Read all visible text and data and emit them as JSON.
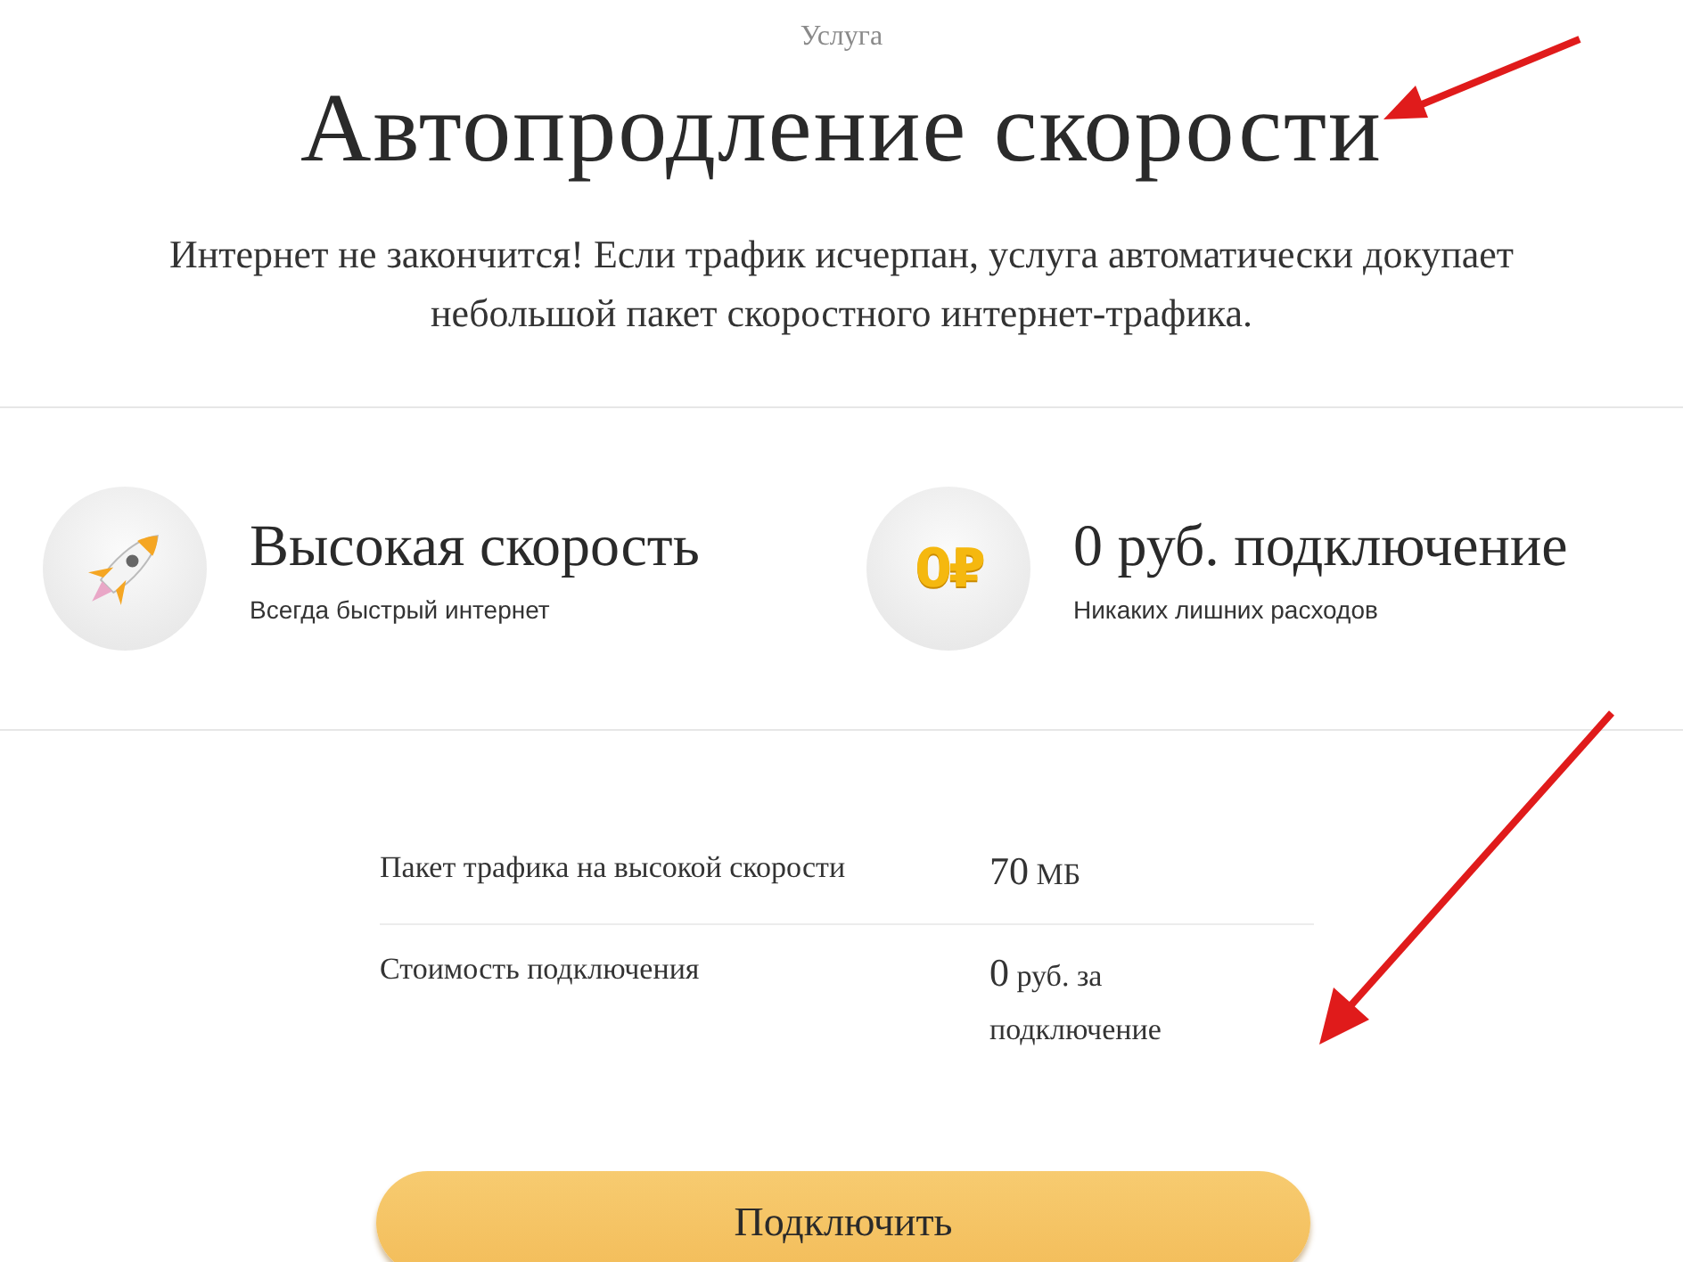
{
  "header": {
    "eyebrow": "Услуга",
    "title": "Автопродление скорости",
    "description": "Интернет не закончится! Если трафик исчерпан, услуга автоматически докупает небольшой пакет скоростного интернет-трафика."
  },
  "features": [
    {
      "kind": "rocket",
      "title": "Высокая скорость",
      "subtitle": "Всегда быстрый интернет"
    },
    {
      "kind": "coin",
      "badge": "0₽",
      "title": "0 руб. подключение",
      "subtitle": "Никаких лишних расходов"
    }
  ],
  "details": [
    {
      "label": "Пакет трафика на высокой скорости",
      "amount": "70",
      "unit": "МБ"
    },
    {
      "label": "Стоимость подключения",
      "amount": "0",
      "unit": "руб. за подключение"
    }
  ],
  "button": "Подключить"
}
